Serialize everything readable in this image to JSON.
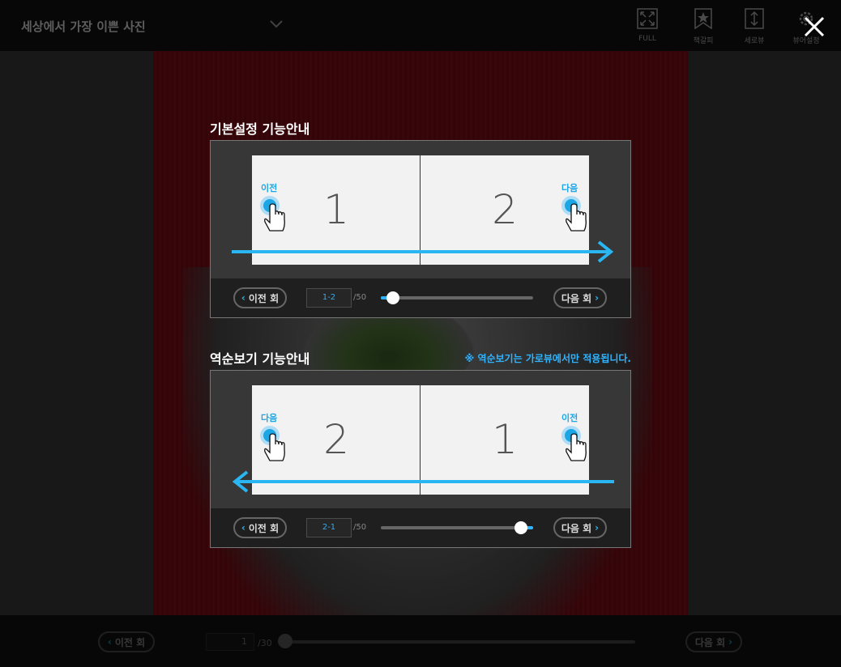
{
  "header": {
    "title": "세상에서 가장 이쁜 사진",
    "tools": [
      {
        "label": "FULL",
        "icon": "fullscreen-icon"
      },
      {
        "label": "책갈피",
        "icon": "bookmark-icon"
      },
      {
        "label": "세로뷰",
        "icon": "vertical-view-icon"
      },
      {
        "label": "뷰어설정",
        "icon": "gear-icon"
      }
    ],
    "close_icon": "close-icon"
  },
  "footer": {
    "prev_label": "이전 회",
    "next_label": "다음 회",
    "page_value": "1",
    "page_total": "/30",
    "progress": 0.0
  },
  "guide": {
    "basic": {
      "heading": "기본설정 기능안내",
      "left_page": "1",
      "right_page": "2",
      "left_tap": "이전",
      "right_tap": "다음",
      "arrow_direction": "right",
      "prev_label": "이전 회",
      "next_label": "다음 회",
      "page_value": "1-2",
      "page_total": "/50",
      "progress": 0.0
    },
    "reverse": {
      "heading": "역순보기 기능안내",
      "note": "※ 역순보기는 가로뷰에서만 적용됩니다.",
      "left_page": "2",
      "right_page": "1",
      "left_tap": "다음",
      "right_tap": "이전",
      "arrow_direction": "left",
      "prev_label": "이전 회",
      "next_label": "다음 회",
      "page_value": "2-1",
      "page_total": "/50",
      "progress": 1.0
    }
  },
  "colors": {
    "accent": "#29b6f2",
    "page_bg": "#6b0c14"
  }
}
